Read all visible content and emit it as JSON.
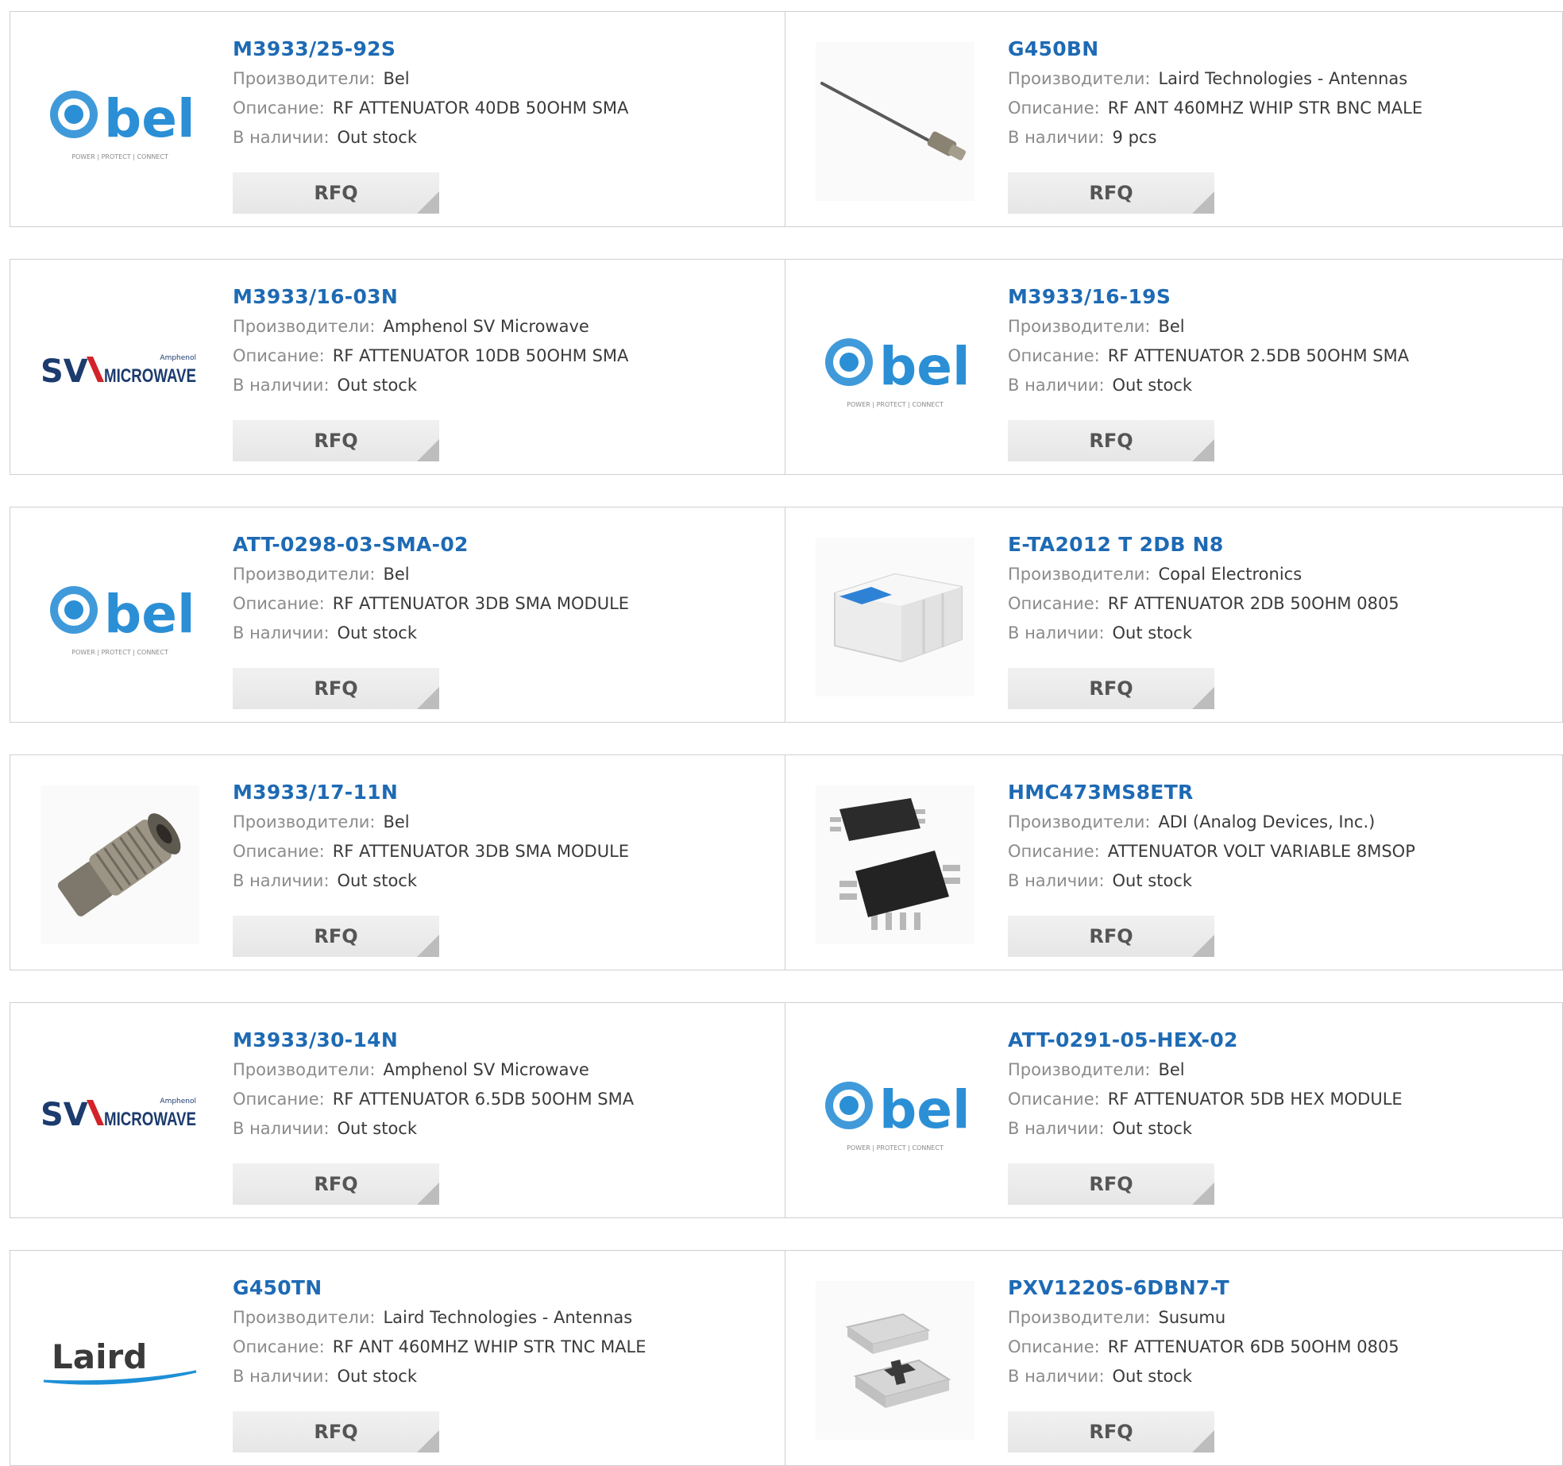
{
  "labels": {
    "manufacturer": "Производители:",
    "description": "Описание:",
    "stock": "В наличии:",
    "rfq": "RFQ"
  },
  "logos": {
    "bel": {
      "text": "bel",
      "tagline": "POWER | PROTECT | CONNECT"
    },
    "sv": {
      "big": "SV",
      "small": "MICROWAVE",
      "sup": "Amphenol"
    },
    "laird": {
      "text": "Laird"
    }
  },
  "colors": {
    "link": "#1e6ab4",
    "bel_blue": "#2b8fd6",
    "sv_navy": "#1c3b6e",
    "sv_red": "#d2232a"
  },
  "products": [
    {
      "part": "M3933/25-92S",
      "manufacturer": "Bel",
      "description": "RF ATTENUATOR 40DB 50OHM SMA",
      "stock": "Out stock",
      "image": "bel-logo"
    },
    {
      "part": "G450BN",
      "manufacturer": "Laird Technologies - Antennas",
      "description": "RF ANT 460MHZ WHIP STR BNC MALE",
      "stock": "9 pcs",
      "image": "whip-antenna-photo"
    },
    {
      "part": "M3933/16-03N",
      "manufacturer": "Amphenol SV Microwave",
      "description": "RF ATTENUATOR 10DB 50OHM SMA",
      "stock": "Out stock",
      "image": "sv-microwave-logo"
    },
    {
      "part": "M3933/16-19S",
      "manufacturer": "Bel",
      "description": "RF ATTENUATOR 2.5DB 50OHM SMA",
      "stock": "Out stock",
      "image": "bel-logo"
    },
    {
      "part": "ATT-0298-03-SMA-02",
      "manufacturer": "Bel",
      "description": "RF ATTENUATOR 3DB SMA MODULE",
      "stock": "Out stock",
      "image": "bel-logo"
    },
    {
      "part": "E-TA2012 T 2DB N8",
      "manufacturer": "Copal Electronics",
      "description": "RF ATTENUATOR 2DB 50OHM 0805",
      "stock": "Out stock",
      "image": "chip-attenuator-photo"
    },
    {
      "part": "M3933/17-11N",
      "manufacturer": "Bel",
      "description": "RF ATTENUATOR 3DB SMA MODULE",
      "stock": "Out stock",
      "image": "coax-attenuator-photo"
    },
    {
      "part": "HMC473MS8ETR",
      "manufacturer": "ADI (Analog Devices, Inc.)",
      "description": "ATTENUATOR VOLT VARIABLE 8MSOP",
      "stock": "Out stock",
      "image": "msop-ic-photo"
    },
    {
      "part": "M3933/30-14N",
      "manufacturer": "Amphenol SV Microwave",
      "description": "RF ATTENUATOR 6.5DB 50OHM SMA",
      "stock": "Out stock",
      "image": "sv-microwave-logo"
    },
    {
      "part": "ATT-0291-05-HEX-02",
      "manufacturer": "Bel",
      "description": "RF ATTENUATOR 5DB HEX MODULE",
      "stock": "Out stock",
      "image": "bel-logo"
    },
    {
      "part": "G450TN",
      "manufacturer": "Laird Technologies - Antennas",
      "description": "RF ANT 460MHZ WHIP STR TNC MALE",
      "stock": "Out stock",
      "image": "laird-logo"
    },
    {
      "part": "PXV1220S-6DBN7-T",
      "manufacturer": "Susumu",
      "description": "RF ATTENUATOR 6DB 50OHM 0805",
      "stock": "Out stock",
      "image": "smd-chip-photo"
    }
  ]
}
